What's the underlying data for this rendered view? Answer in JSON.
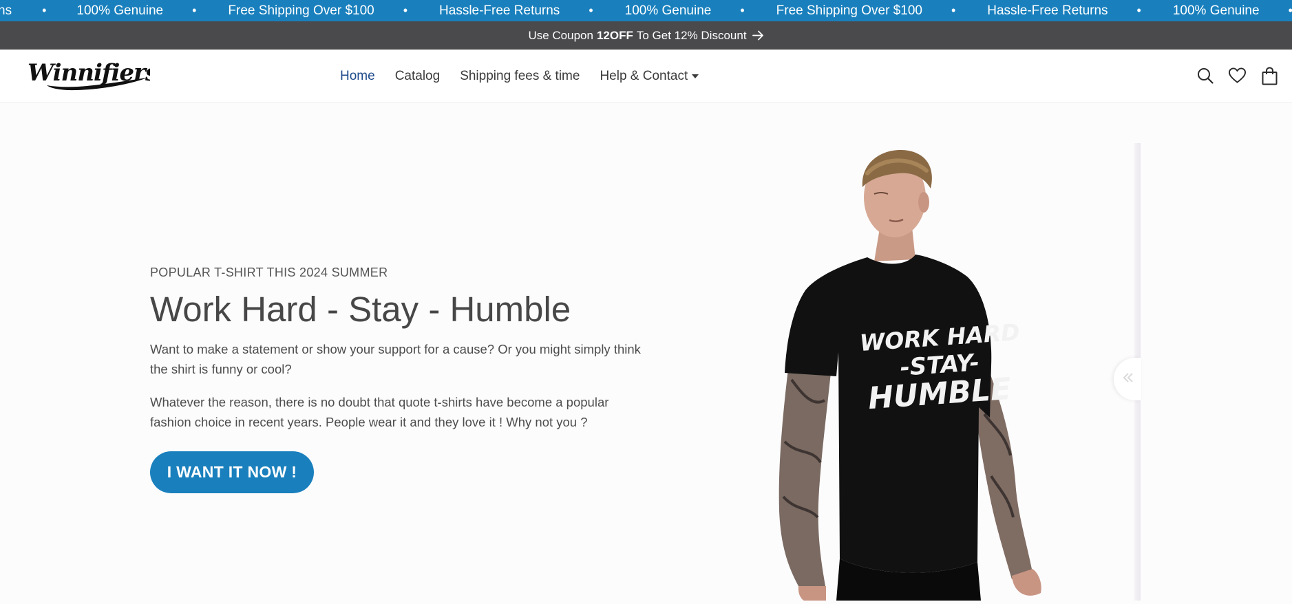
{
  "announcement": {
    "items": [
      "ns",
      "100% Genuine",
      "Free Shipping Over $100",
      "Hassle-Free Returns",
      "100% Genuine",
      "Free Shipping Over $100",
      "Hassle-Free Returns",
      "100% Genuine"
    ],
    "separator": "•"
  },
  "coupon": {
    "prefix": "Use Coupon",
    "code": "12OFF",
    "suffix": "To Get 12% Discount",
    "arrow_icon": "arrow-right-icon"
  },
  "header": {
    "logo_text": "Winnifiers",
    "nav": [
      {
        "label": "Home",
        "active": true
      },
      {
        "label": "Catalog",
        "active": false
      },
      {
        "label": "Shipping fees & time",
        "active": false
      },
      {
        "label": "Help & Contact",
        "active": false,
        "has_dropdown": true
      }
    ],
    "icons": [
      "search-icon",
      "heart-icon",
      "bag-icon"
    ]
  },
  "hero": {
    "eyebrow": "POPULAR T-SHIRT THIS 2024 SUMMER",
    "title": "Work Hard - Stay - Humble",
    "paragraph1": "Want to make a statement or show your support for a cause? Or you might simply think the shirt is funny or cool?",
    "paragraph2": "Whatever the reason, there is no doubt that quote t-shirts have become a popular fashion choice in recent years. People wear it and they love it ! Why not you ?",
    "cta_label": "I WANT IT NOW !",
    "shirt_print": [
      "WORK HARD",
      "-STAY-",
      "HUMBLE"
    ]
  },
  "colors": {
    "accent": "#1a80bd",
    "coupon_bg": "#4a4a4d",
    "nav_active": "#1d4a8b"
  }
}
